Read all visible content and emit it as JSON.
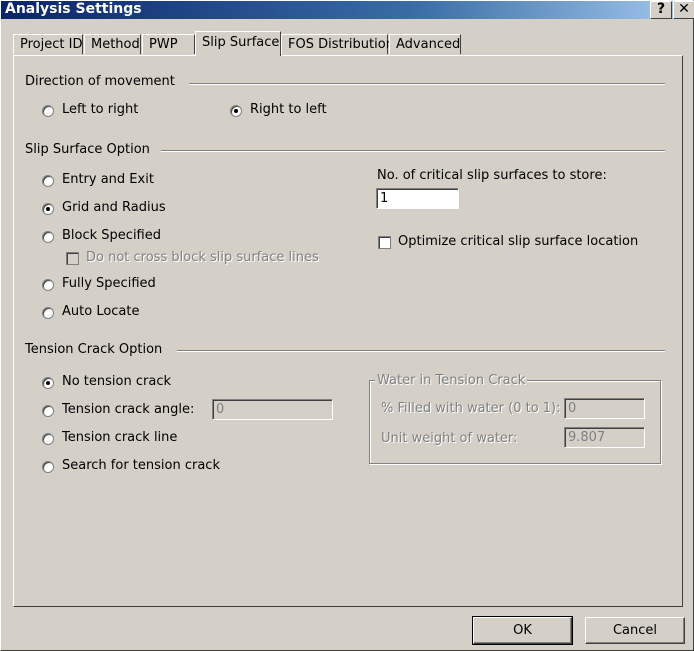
{
  "window": {
    "title": "Analysis Settings",
    "help_label": "?",
    "close_label": "✕"
  },
  "tabs": [
    {
      "label": "Project ID"
    },
    {
      "label": "Method"
    },
    {
      "label": "PWP"
    },
    {
      "label": "Slip Surface"
    },
    {
      "label": "FOS Distribution"
    },
    {
      "label": "Advanced"
    }
  ],
  "active_tab": "Slip Surface",
  "direction": {
    "heading": "Direction of movement",
    "options": [
      {
        "label": "Left to right",
        "selected": false
      },
      {
        "label": "Right to left",
        "selected": true
      }
    ]
  },
  "slip_surface": {
    "heading": "Slip Surface Option",
    "options": [
      {
        "label": "Entry and Exit",
        "selected": false
      },
      {
        "label": "Grid and Radius",
        "selected": true
      },
      {
        "label": "Block Specified",
        "selected": false
      },
      {
        "label": "Fully Specified",
        "selected": false
      },
      {
        "label": "Auto Locate",
        "selected": false
      }
    ],
    "block_checkbox": {
      "label": "Do not cross block slip surface lines",
      "checked": false,
      "disabled": true
    },
    "critical_store_label": "No. of critical slip surfaces to store:",
    "critical_store_value": "1",
    "optimize": {
      "label": "Optimize critical slip surface location",
      "checked": false
    }
  },
  "tension_crack": {
    "heading": "Tension Crack Option",
    "options": [
      {
        "label": "No tension crack",
        "selected": true
      },
      {
        "label": "Tension crack angle:",
        "selected": false
      },
      {
        "label": "Tension crack line",
        "selected": false
      },
      {
        "label": "Search for tension crack",
        "selected": false
      }
    ],
    "angle_value": "0",
    "water_group": {
      "title": "Water in Tension Crack",
      "filled_label": "% Filled with water (0 to 1):",
      "filled_value": "0",
      "unit_weight_label": "Unit weight of water:",
      "unit_weight_value": "9.807"
    }
  },
  "buttons": {
    "ok": "OK",
    "cancel": "Cancel"
  }
}
